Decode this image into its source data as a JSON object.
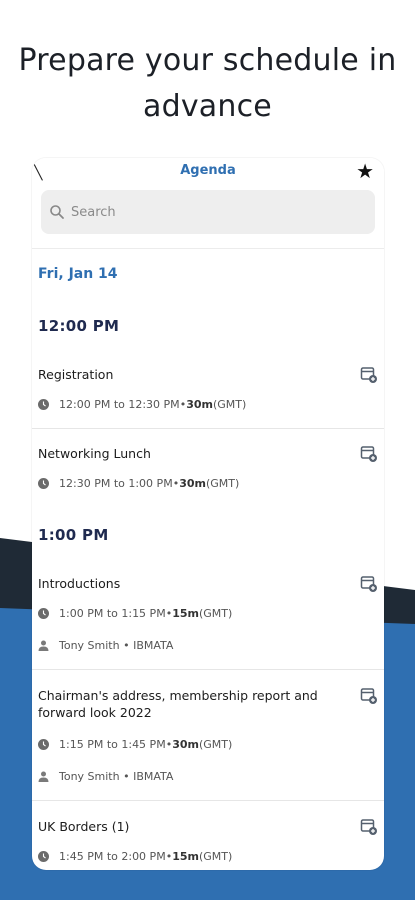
{
  "headline": [
    "Prepare your schedule in",
    "advance"
  ],
  "appbar": {
    "title": "Agenda"
  },
  "search": {
    "placeholder": "Search"
  },
  "date": "Fri, Jan 14",
  "times": [
    "12:00 PM",
    "1:00 PM"
  ],
  "sessions": [
    {
      "title": "Registration",
      "time": "12:00 PM to 12:30 PM",
      "sep": " • ",
      "duration": "30m",
      "tz": " (GMT)"
    },
    {
      "title": "Networking Lunch",
      "time": "12:30 PM to 1:00 PM",
      "sep": " • ",
      "duration": "30m",
      "tz": " (GMT)"
    },
    {
      "title": "Introductions",
      "time": "1:00 PM to 1:15 PM",
      "sep": " • ",
      "duration": "15m",
      "tz": " (GMT)",
      "speaker": "Tony Smith • IBMATA"
    },
    {
      "title": "Chairman's address, membership report and forward look 2022",
      "time": "1:15 PM to 1:45 PM",
      "sep": " • ",
      "duration": "30m",
      "tz": " (GMT)",
      "speaker": "Tony Smith • IBMATA"
    },
    {
      "title": "UK Borders (1)",
      "time": "1:45 PM to 2:00 PM",
      "sep": " • ",
      "duration": "15m",
      "tz": " (GMT)"
    }
  ],
  "colors": {
    "accent": "#2f6fb1",
    "dark": "#1f2a36",
    "heading": "#1f2a4f"
  },
  "icons": [
    "back-icon",
    "star-icon",
    "search-icon",
    "clock-icon",
    "person-icon",
    "add-to-calendar-icon"
  ]
}
